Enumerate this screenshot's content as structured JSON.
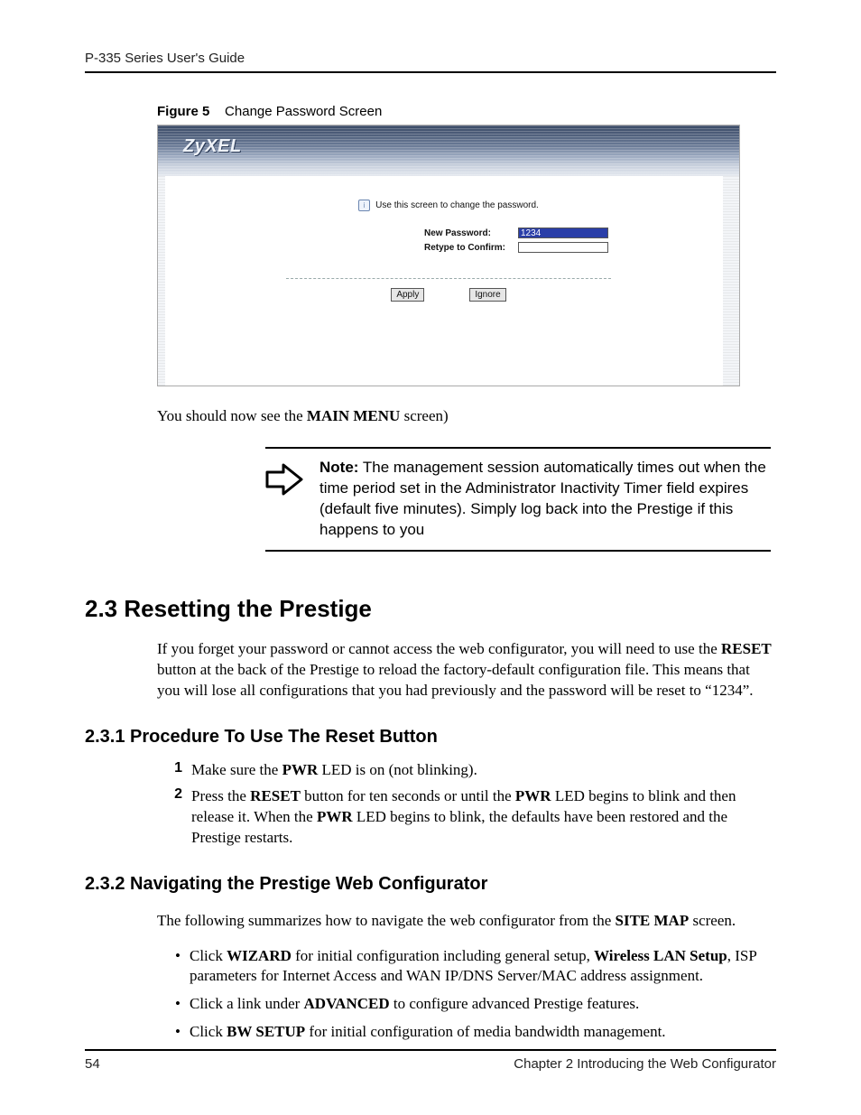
{
  "doc": {
    "running_head": "P-335 Series User's Guide",
    "page_number": "54",
    "chapter_footer": "Chapter 2 Introducing the Web Configurator"
  },
  "figure": {
    "label": "Figure 5",
    "title": "Change Password Screen"
  },
  "screenshot": {
    "brand": "ZyXEL",
    "info_text": "Use this screen to change the password.",
    "new_password_label": "New Password:",
    "new_password_value": "1234",
    "retype_label": "Retype to Confirm:",
    "retype_value": "",
    "apply_label": "Apply",
    "ignore_label": "Ignore"
  },
  "body": {
    "after_fig_prefix": "You should now see the ",
    "after_fig_bold": "MAIN MENU",
    "after_fig_suffix": " screen)"
  },
  "note": {
    "label": "Note:",
    "text": " The management session automatically times out when the time period set in the Administrator Inactivity Timer field expires (default five minutes). Simply log back into the Prestige if this happens to you"
  },
  "sec23": {
    "heading": "2.3  Resetting the Prestige",
    "para_1a": "If you forget your password or cannot access the web configurator, you will need to use the ",
    "para_1b_bold": "RESET",
    "para_1c": " button at the back of the Prestige to reload the factory-default configuration file. This means that you will lose all configurations that you had previously and the password will be reset to “1234”."
  },
  "sec231": {
    "heading": "2.3.1  Procedure To Use The Reset Button",
    "item1_num": "1",
    "item1_a": "Make sure the ",
    "item1_b_bold": "PWR",
    "item1_c": " LED is on (not blinking).",
    "item2_num": "2",
    "item2_a": "Press the ",
    "item2_b_bold": "RESET",
    "item2_c": " button for ten seconds or until the ",
    "item2_d_bold": "PWR",
    "item2_e": " LED begins to blink and then release it. When the ",
    "item2_f_bold": "PWR",
    "item2_g": " LED begins to blink, the defaults have been restored and the Prestige restarts."
  },
  "sec232": {
    "heading": "2.3.2  Navigating the Prestige Web Configurator",
    "intro_a": "The following summarizes how to navigate the web configurator from the ",
    "intro_b_bold": "SITE MAP",
    "intro_c": " screen.",
    "b1_a": "Click ",
    "b1_b_bold": "WIZARD",
    "b1_c": " for initial configuration including general setup, ",
    "b1_d_bold": "Wireless LAN Setup",
    "b1_e": ", ISP parameters for Internet Access and WAN IP/DNS Server/MAC address assignment.",
    "b2_a": "Click a link under ",
    "b2_b_bold": "ADVANCED",
    "b2_c": " to configure advanced Prestige features.",
    "b3_a": "Click ",
    "b3_b_bold": "BW SETUP",
    "b3_c": " for initial configuration of media bandwidth management."
  }
}
